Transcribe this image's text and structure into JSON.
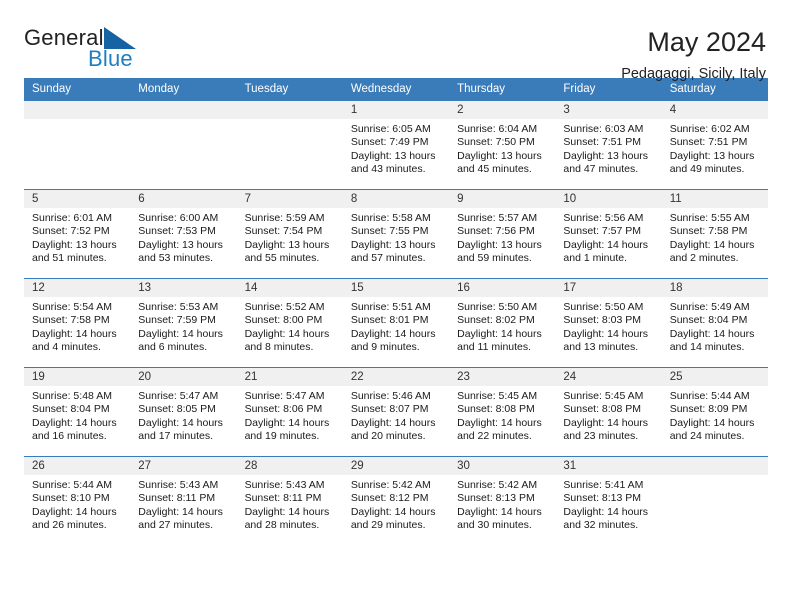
{
  "brand": {
    "name_part1": "General",
    "name_part2": "Blue",
    "accent_color": "#1c7fc4",
    "triangle_color": "#1663a4"
  },
  "header": {
    "title": "May 2024",
    "location": "Pedagaggi, Sicily, Italy",
    "header_bg_color": "#3a7cb9"
  },
  "columns": [
    "Sunday",
    "Monday",
    "Tuesday",
    "Wednesday",
    "Thursday",
    "Friday",
    "Saturday"
  ],
  "weeks": [
    [
      {
        "day": "",
        "blank": true
      },
      {
        "day": "",
        "blank": true
      },
      {
        "day": "",
        "blank": true
      },
      {
        "day": "1",
        "sunrise": "Sunrise: 6:05 AM",
        "sunset": "Sunset: 7:49 PM",
        "daylight": "Daylight: 13 hours and 43 minutes."
      },
      {
        "day": "2",
        "sunrise": "Sunrise: 6:04 AM",
        "sunset": "Sunset: 7:50 PM",
        "daylight": "Daylight: 13 hours and 45 minutes."
      },
      {
        "day": "3",
        "sunrise": "Sunrise: 6:03 AM",
        "sunset": "Sunset: 7:51 PM",
        "daylight": "Daylight: 13 hours and 47 minutes."
      },
      {
        "day": "4",
        "sunrise": "Sunrise: 6:02 AM",
        "sunset": "Sunset: 7:51 PM",
        "daylight": "Daylight: 13 hours and 49 minutes."
      }
    ],
    [
      {
        "day": "5",
        "sunrise": "Sunrise: 6:01 AM",
        "sunset": "Sunset: 7:52 PM",
        "daylight": "Daylight: 13 hours and 51 minutes."
      },
      {
        "day": "6",
        "sunrise": "Sunrise: 6:00 AM",
        "sunset": "Sunset: 7:53 PM",
        "daylight": "Daylight: 13 hours and 53 minutes."
      },
      {
        "day": "7",
        "sunrise": "Sunrise: 5:59 AM",
        "sunset": "Sunset: 7:54 PM",
        "daylight": "Daylight: 13 hours and 55 minutes."
      },
      {
        "day": "8",
        "sunrise": "Sunrise: 5:58 AM",
        "sunset": "Sunset: 7:55 PM",
        "daylight": "Daylight: 13 hours and 57 minutes."
      },
      {
        "day": "9",
        "sunrise": "Sunrise: 5:57 AM",
        "sunset": "Sunset: 7:56 PM",
        "daylight": "Daylight: 13 hours and 59 minutes."
      },
      {
        "day": "10",
        "sunrise": "Sunrise: 5:56 AM",
        "sunset": "Sunset: 7:57 PM",
        "daylight": "Daylight: 14 hours and 1 minute."
      },
      {
        "day": "11",
        "sunrise": "Sunrise: 5:55 AM",
        "sunset": "Sunset: 7:58 PM",
        "daylight": "Daylight: 14 hours and 2 minutes."
      }
    ],
    [
      {
        "day": "12",
        "sunrise": "Sunrise: 5:54 AM",
        "sunset": "Sunset: 7:58 PM",
        "daylight": "Daylight: 14 hours and 4 minutes."
      },
      {
        "day": "13",
        "sunrise": "Sunrise: 5:53 AM",
        "sunset": "Sunset: 7:59 PM",
        "daylight": "Daylight: 14 hours and 6 minutes."
      },
      {
        "day": "14",
        "sunrise": "Sunrise: 5:52 AM",
        "sunset": "Sunset: 8:00 PM",
        "daylight": "Daylight: 14 hours and 8 minutes."
      },
      {
        "day": "15",
        "sunrise": "Sunrise: 5:51 AM",
        "sunset": "Sunset: 8:01 PM",
        "daylight": "Daylight: 14 hours and 9 minutes."
      },
      {
        "day": "16",
        "sunrise": "Sunrise: 5:50 AM",
        "sunset": "Sunset: 8:02 PM",
        "daylight": "Daylight: 14 hours and 11 minutes."
      },
      {
        "day": "17",
        "sunrise": "Sunrise: 5:50 AM",
        "sunset": "Sunset: 8:03 PM",
        "daylight": "Daylight: 14 hours and 13 minutes."
      },
      {
        "day": "18",
        "sunrise": "Sunrise: 5:49 AM",
        "sunset": "Sunset: 8:04 PM",
        "daylight": "Daylight: 14 hours and 14 minutes."
      }
    ],
    [
      {
        "day": "19",
        "sunrise": "Sunrise: 5:48 AM",
        "sunset": "Sunset: 8:04 PM",
        "daylight": "Daylight: 14 hours and 16 minutes."
      },
      {
        "day": "20",
        "sunrise": "Sunrise: 5:47 AM",
        "sunset": "Sunset: 8:05 PM",
        "daylight": "Daylight: 14 hours and 17 minutes."
      },
      {
        "day": "21",
        "sunrise": "Sunrise: 5:47 AM",
        "sunset": "Sunset: 8:06 PM",
        "daylight": "Daylight: 14 hours and 19 minutes."
      },
      {
        "day": "22",
        "sunrise": "Sunrise: 5:46 AM",
        "sunset": "Sunset: 8:07 PM",
        "daylight": "Daylight: 14 hours and 20 minutes."
      },
      {
        "day": "23",
        "sunrise": "Sunrise: 5:45 AM",
        "sunset": "Sunset: 8:08 PM",
        "daylight": "Daylight: 14 hours and 22 minutes."
      },
      {
        "day": "24",
        "sunrise": "Sunrise: 5:45 AM",
        "sunset": "Sunset: 8:08 PM",
        "daylight": "Daylight: 14 hours and 23 minutes."
      },
      {
        "day": "25",
        "sunrise": "Sunrise: 5:44 AM",
        "sunset": "Sunset: 8:09 PM",
        "daylight": "Daylight: 14 hours and 24 minutes."
      }
    ],
    [
      {
        "day": "26",
        "sunrise": "Sunrise: 5:44 AM",
        "sunset": "Sunset: 8:10 PM",
        "daylight": "Daylight: 14 hours and 26 minutes."
      },
      {
        "day": "27",
        "sunrise": "Sunrise: 5:43 AM",
        "sunset": "Sunset: 8:11 PM",
        "daylight": "Daylight: 14 hours and 27 minutes."
      },
      {
        "day": "28",
        "sunrise": "Sunrise: 5:43 AM",
        "sunset": "Sunset: 8:11 PM",
        "daylight": "Daylight: 14 hours and 28 minutes."
      },
      {
        "day": "29",
        "sunrise": "Sunrise: 5:42 AM",
        "sunset": "Sunset: 8:12 PM",
        "daylight": "Daylight: 14 hours and 29 minutes."
      },
      {
        "day": "30",
        "sunrise": "Sunrise: 5:42 AM",
        "sunset": "Sunset: 8:13 PM",
        "daylight": "Daylight: 14 hours and 30 minutes."
      },
      {
        "day": "31",
        "sunrise": "Sunrise: 5:41 AM",
        "sunset": "Sunset: 8:13 PM",
        "daylight": "Daylight: 14 hours and 32 minutes."
      },
      {
        "day": "",
        "blank": true
      }
    ]
  ]
}
